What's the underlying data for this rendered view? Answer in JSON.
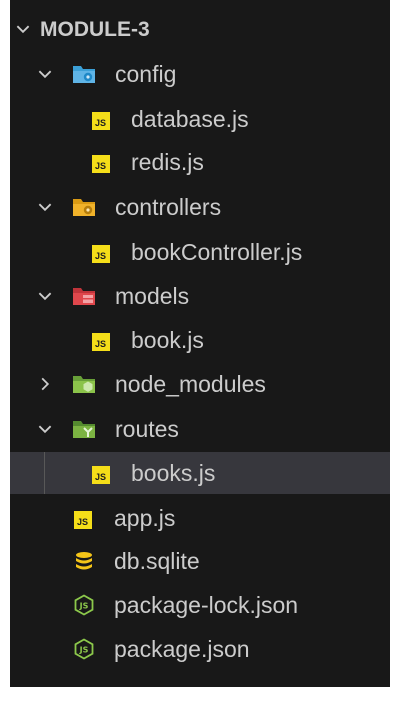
{
  "explorer": {
    "root": {
      "label": "MODULE-3",
      "expanded": true
    },
    "items": [
      {
        "label": "config",
        "type": "folder",
        "expanded": true,
        "icon": "config-folder-icon",
        "color": "#3b9fd6"
      },
      {
        "label": "database.js",
        "type": "file",
        "icon": "js-file-icon"
      },
      {
        "label": "redis.js",
        "type": "file",
        "icon": "js-file-icon"
      },
      {
        "label": "controllers",
        "type": "folder",
        "expanded": true,
        "icon": "controllers-folder-icon",
        "color": "#f0b22a"
      },
      {
        "label": "bookController.js",
        "type": "file",
        "icon": "js-file-icon"
      },
      {
        "label": "models",
        "type": "folder",
        "expanded": true,
        "icon": "models-folder-icon",
        "color": "#e0474c"
      },
      {
        "label": "book.js",
        "type": "file",
        "icon": "js-file-icon"
      },
      {
        "label": "node_modules",
        "type": "folder",
        "expanded": false,
        "icon": "node-modules-folder-icon",
        "color": "#8bc34a"
      },
      {
        "label": "routes",
        "type": "folder",
        "expanded": true,
        "icon": "routes-folder-icon",
        "color": "#7cb342"
      },
      {
        "label": "books.js",
        "type": "file",
        "icon": "js-file-icon",
        "selected": true
      },
      {
        "label": "app.js",
        "type": "file",
        "icon": "js-file-icon"
      },
      {
        "label": "db.sqlite",
        "type": "file",
        "icon": "database-icon"
      },
      {
        "label": "package-lock.json",
        "type": "file",
        "icon": "nodejs-icon"
      },
      {
        "label": "package.json",
        "type": "file",
        "icon": "nodejs-icon"
      }
    ],
    "js_badge": "JS",
    "colors": {
      "background": "#181818",
      "selected": "#37373d",
      "text": "#cccccc",
      "js": "#f5de19",
      "sqlite": "#f5c518",
      "node": "#8cc84b"
    }
  }
}
